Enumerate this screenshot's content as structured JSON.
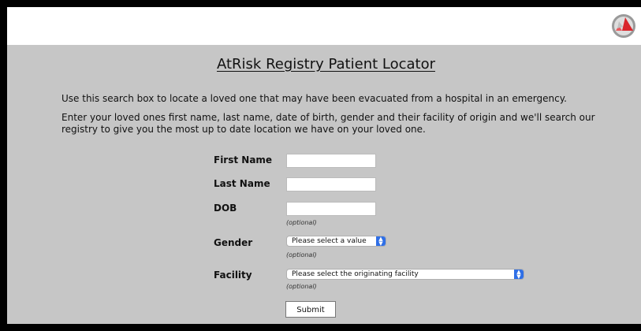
{
  "header": {
    "logo_icon": "atrisk-logo-icon"
  },
  "page": {
    "title": "AtRisk Registry Patient Locator",
    "intro": "Use this search box to locate a loved one that may have been evacuated from a hospital in an emergency.",
    "instructions": "Enter your loved ones first name, last name, date of birth, gender and their facility of origin and we'll search our registry to give you the most up to date location we have on your loved one."
  },
  "form": {
    "first_name": {
      "label": "First Name",
      "value": ""
    },
    "last_name": {
      "label": "Last Name",
      "value": ""
    },
    "dob": {
      "label": "DOB",
      "value": "",
      "note": "(optional)"
    },
    "gender": {
      "label": "Gender",
      "selected": "Please select a value",
      "note": "(optional)"
    },
    "facility": {
      "label": "Facility",
      "selected": "Please select the originating facility",
      "note": "(optional)"
    },
    "submit_label": "Submit"
  },
  "colors": {
    "content_bg": "#c6c6c6",
    "select_accent": "#2f6fe6",
    "logo_red": "#d9262c"
  }
}
